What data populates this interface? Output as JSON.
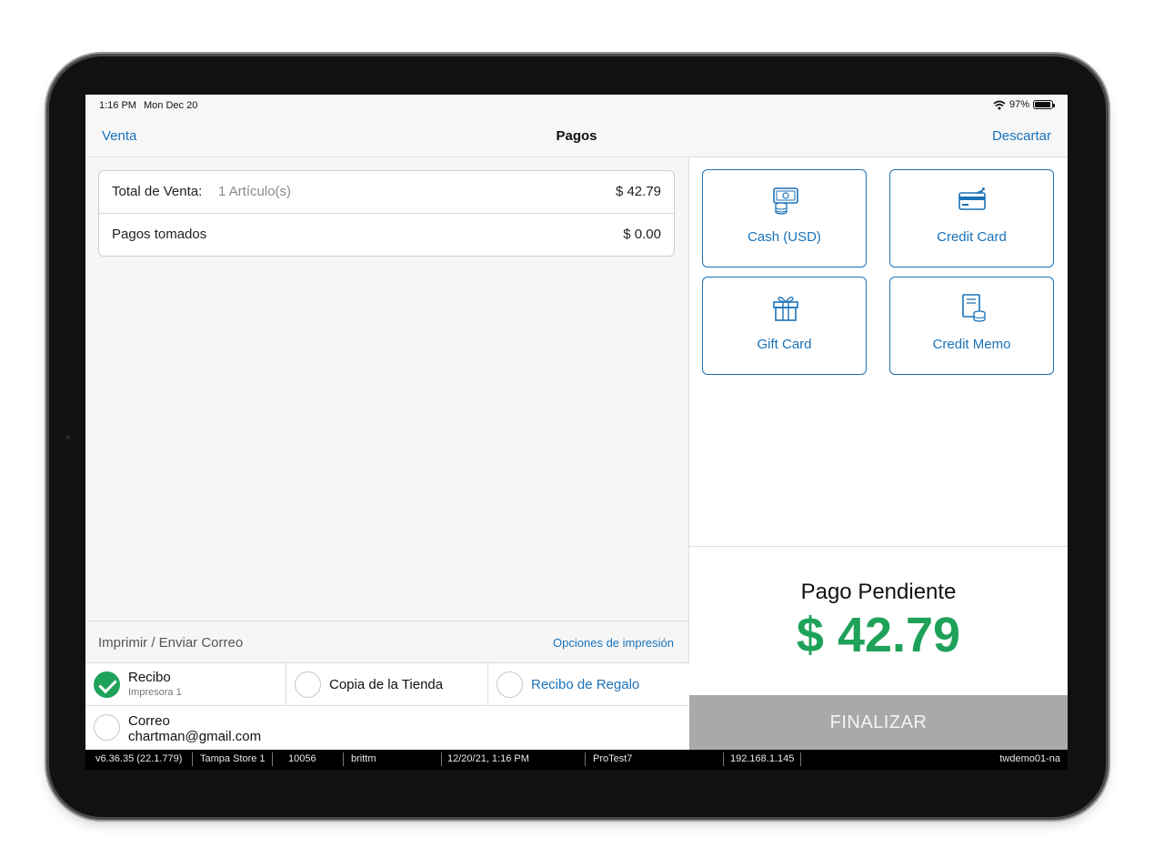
{
  "status_bar": {
    "time": "1:16 PM",
    "date": "Mon Dec 20",
    "battery": "97%",
    "battery_level": 0.97
  },
  "nav": {
    "back_label": "Venta",
    "title": "Pagos",
    "discard_label": "Descartar"
  },
  "summary": {
    "total_label": "Total de Venta:",
    "items_label": "1 Artículo(s)",
    "total_value": "$ 42.79",
    "payments_label": "Pagos tomados",
    "payments_value": "$ 0.00"
  },
  "print": {
    "header_label": "Imprimir / Enviar Correo",
    "options_label": "Opciones de impresión",
    "receipt_label": "Recibo",
    "receipt_sub": "Impresora 1",
    "store_copy_label": "Copia de la Tienda",
    "gift_receipt_label": "Recibo de Regalo",
    "email_label": "Correo",
    "email_value": "chartman@gmail.com"
  },
  "tenders": [
    {
      "label": "Cash (USD)",
      "icon": "cash-icon"
    },
    {
      "label": "Credit Card",
      "icon": "credit-card-icon"
    },
    {
      "label": "Gift Card",
      "icon": "gift-icon"
    },
    {
      "label": "Credit Memo",
      "icon": "credit-memo-icon"
    }
  ],
  "pending": {
    "label": "Pago Pendiente",
    "amount": "$ 42.79"
  },
  "finalize_label": "FINALIZAR",
  "footer": {
    "version": "v6.36.35 (22.1.779)",
    "store": "Tampa Store 1",
    "register": "10056",
    "user": "brittm",
    "datetime": "12/20/21, 1:16 PM",
    "profile": "ProTest7",
    "ip": "192.168.1.145",
    "host": "twdemo01-na"
  },
  "colors": {
    "accent": "#1a72b8",
    "success": "#1ea25a",
    "finalize_bg": "#a9a9a9"
  }
}
